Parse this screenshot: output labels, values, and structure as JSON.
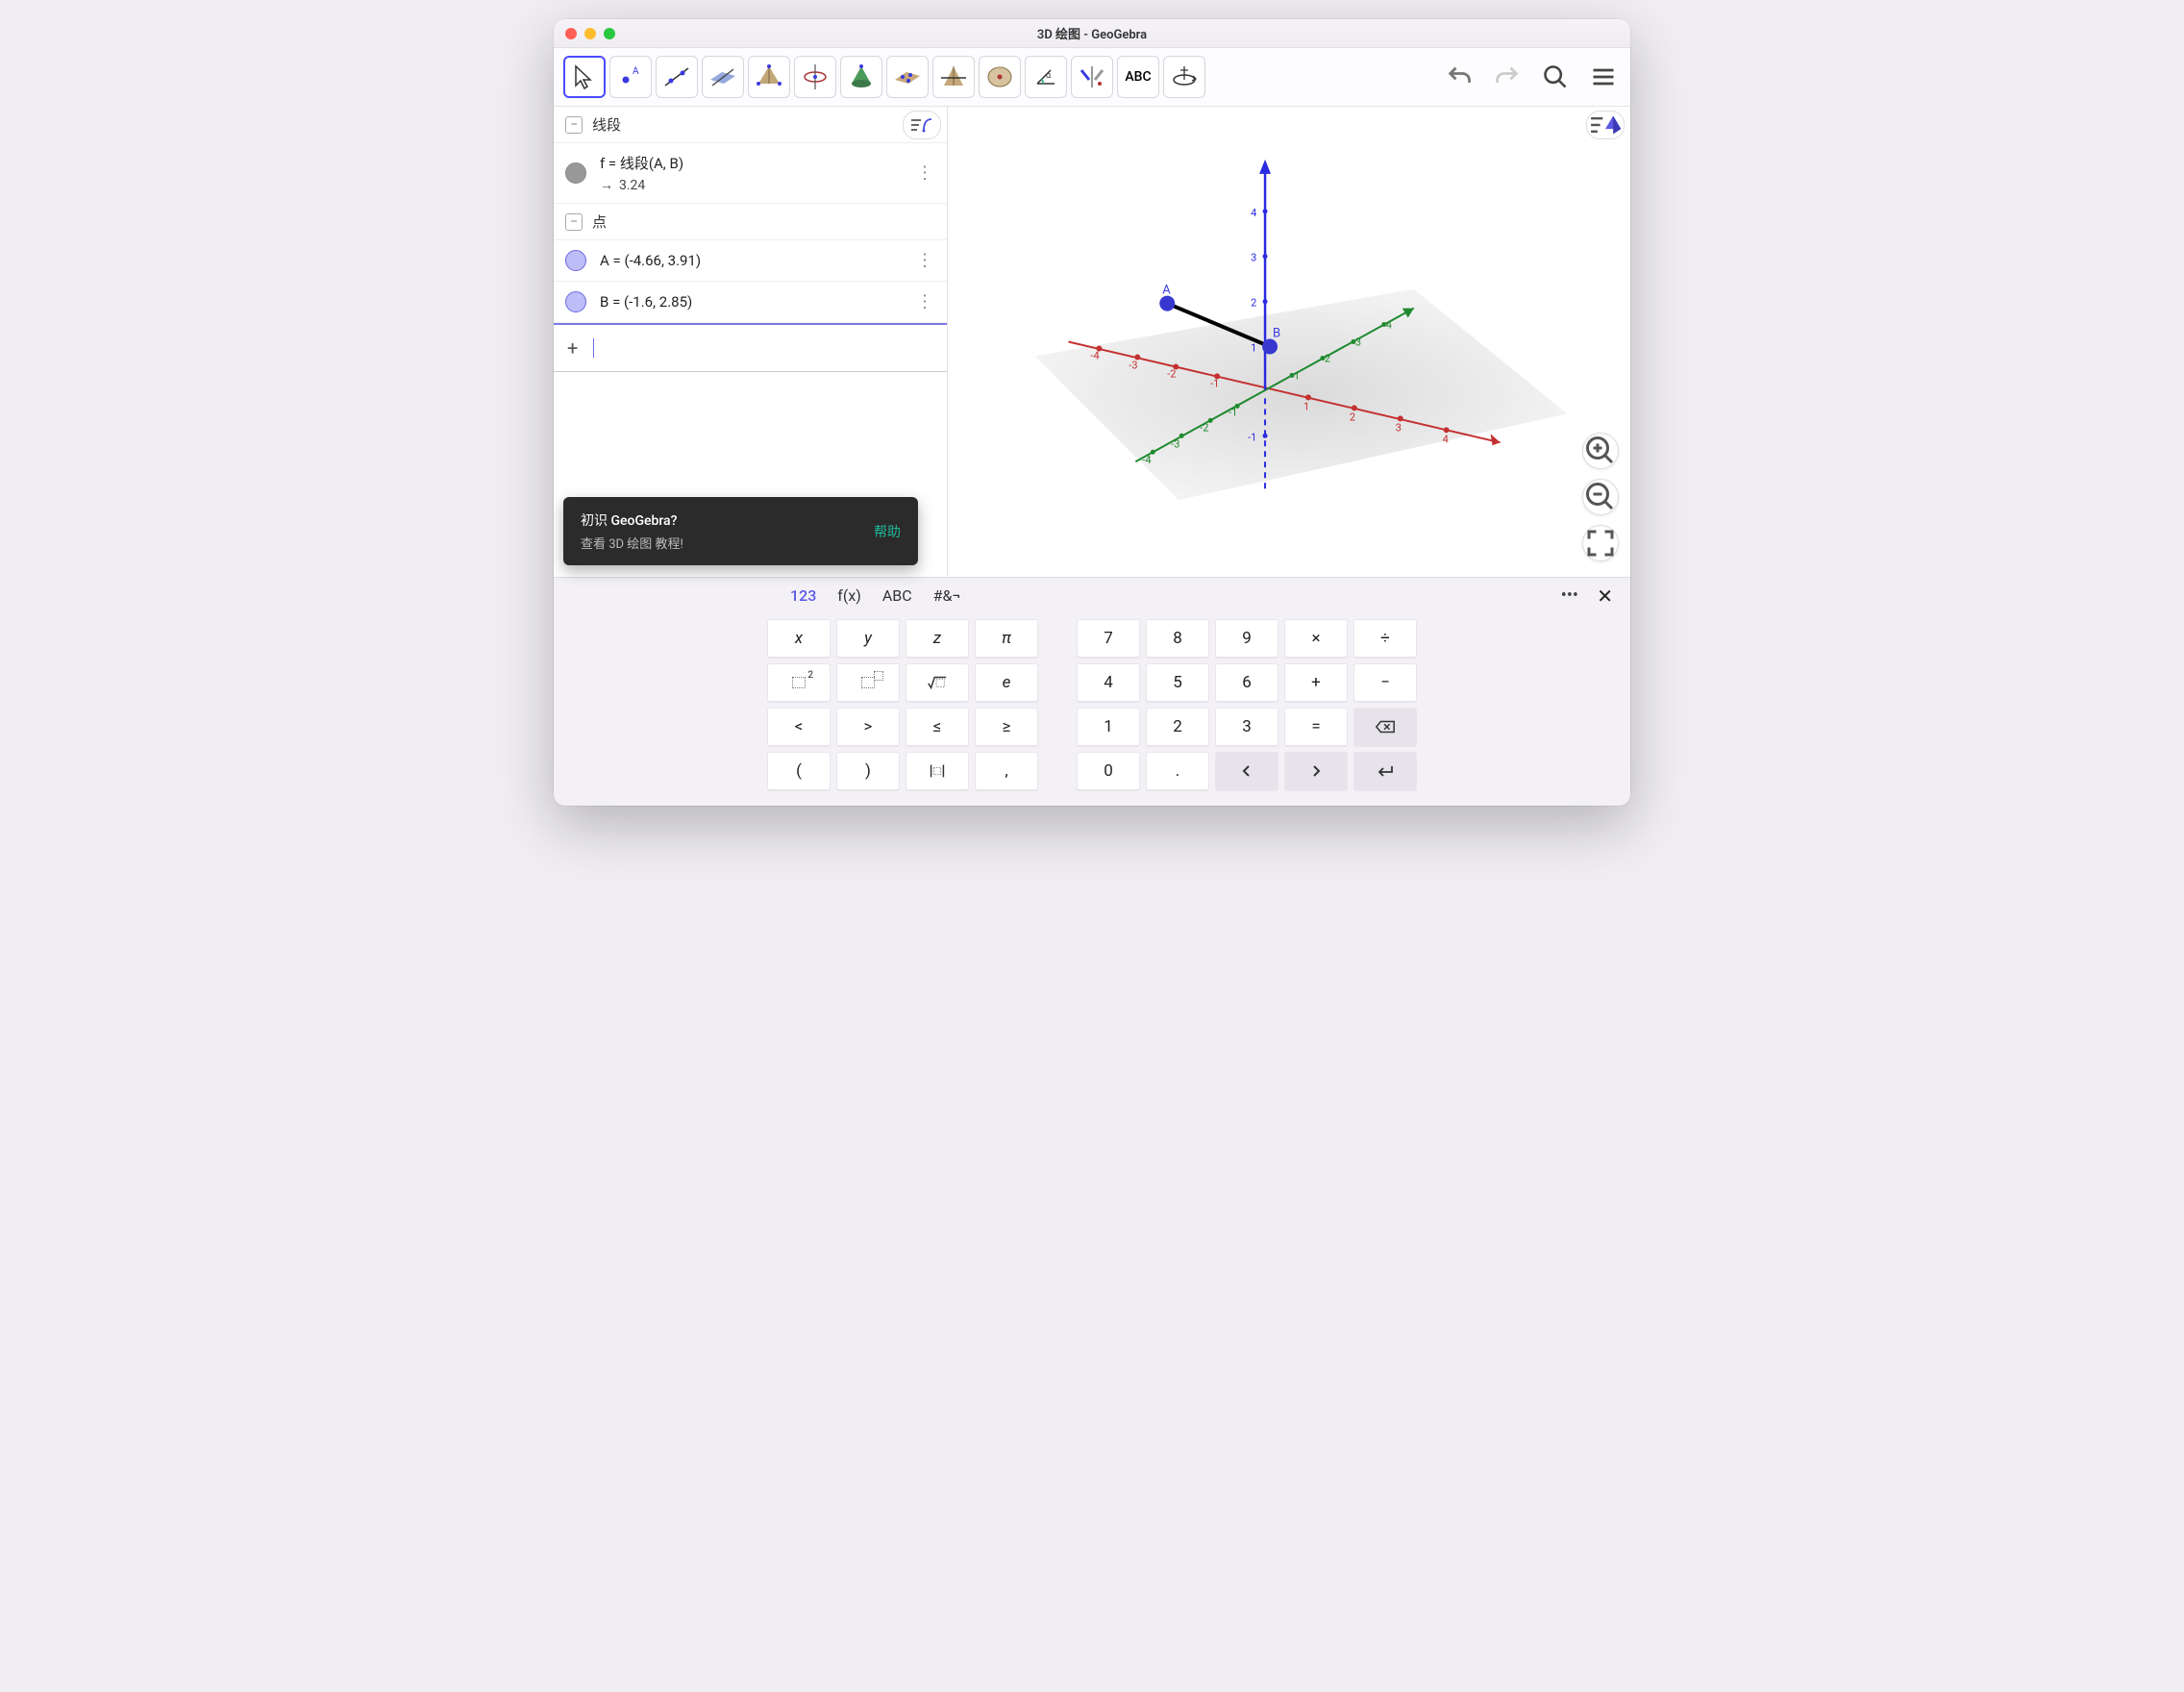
{
  "window": {
    "title": "3D 绘图 - GeoGebra"
  },
  "algebra": {
    "sections": {
      "segment": {
        "label": "线段"
      },
      "points": {
        "label": "点"
      }
    },
    "items": {
      "f": {
        "expr": "f = 线段(A, B)",
        "value": "3.24"
      },
      "A": {
        "expr": "A = (-4.66, 3.91)"
      },
      "B": {
        "expr": "B = (-1.6, 2.85)"
      }
    },
    "help": {
      "title": "初识 GeoGebra?",
      "subtitle": "查看 3D 绘图 教程!",
      "link": "帮助"
    }
  },
  "graphics3d": {
    "points": {
      "A": "A",
      "B": "B"
    },
    "axis_ticks": {
      "x": [
        "-4",
        "-3",
        "-2",
        "-1",
        "1",
        "2",
        "3",
        "4"
      ],
      "y": [
        "-4",
        "-3",
        "-2",
        "-1",
        "1",
        "2",
        "3",
        "4"
      ],
      "z": [
        "-1",
        "1",
        "2",
        "3",
        "4"
      ]
    }
  },
  "keyboard": {
    "tabs": {
      "t123": "123",
      "fx": "f(x)",
      "abc": "ABC",
      "sym": "#&¬"
    },
    "left": [
      [
        "x",
        "y",
        "z",
        "π"
      ],
      [
        "sq",
        "pow",
        "√",
        "e"
      ],
      [
        "<",
        ">",
        "≤",
        "≥"
      ],
      [
        "(",
        ")",
        "abs",
        ","
      ]
    ],
    "right": [
      [
        "7",
        "8",
        "9",
        "×",
        "÷"
      ],
      [
        "4",
        "5",
        "6",
        "+",
        "−"
      ],
      [
        "1",
        "2",
        "3",
        "=",
        "bksp"
      ],
      [
        "0",
        ".",
        "",
        "left",
        "right",
        "enter"
      ]
    ]
  },
  "tool_text": "ABC"
}
